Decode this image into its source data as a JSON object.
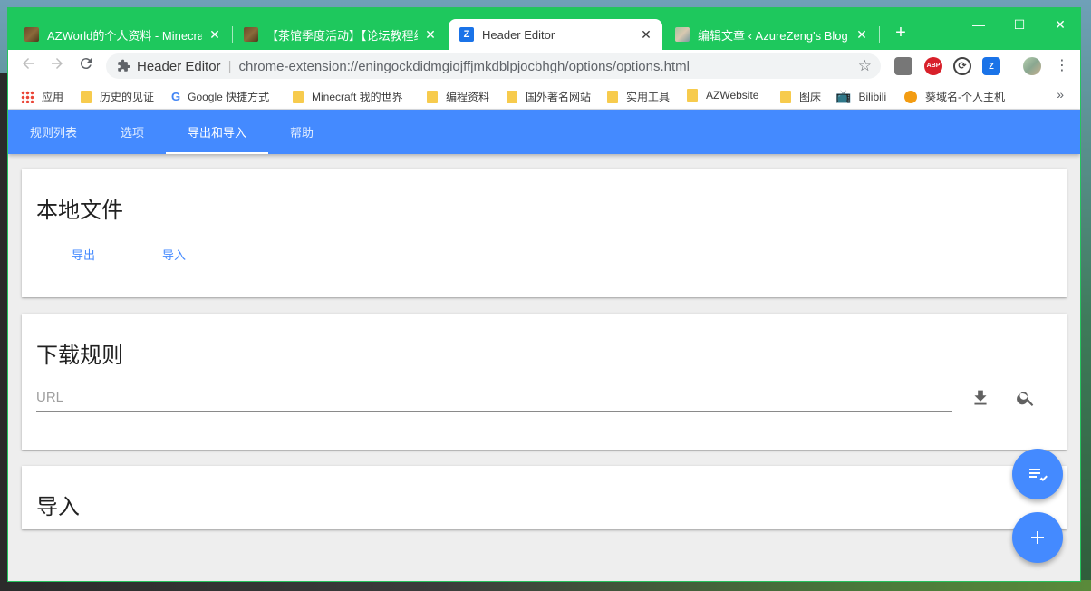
{
  "browser": {
    "tabs": [
      {
        "title": "AZWorld的个人资料 - Minecraft",
        "close": "✕"
      },
      {
        "title": "【茶馆季度活动】【论坛教程组】",
        "close": "✕"
      },
      {
        "title": "Header Editor",
        "close": "✕"
      },
      {
        "title": "编辑文章 ‹ AzureZeng's Blog —",
        "close": "✕"
      }
    ],
    "new_tab": "+",
    "window_controls": {
      "minimize": "—",
      "maximize": "☐",
      "close": "✕"
    },
    "omnibox": {
      "site": "Header Editor",
      "separator": "|",
      "url": "chrome-extension://eningockdidmgiojffjmkdblpjocbhgh/options/options.html"
    },
    "extensions": {
      "abp": "ABP",
      "header_editor": "Z"
    },
    "bookmarks": [
      "应用",
      "历史的见证",
      "Google 快捷方式",
      "Minecraft 我的世界",
      "编程资料",
      "国外著名网站",
      "实用工具",
      "AZWebsite",
      "图床",
      "Bilibili",
      "葵域名-个人主机"
    ],
    "bookmarks_more": "»"
  },
  "app": {
    "nav": [
      "规则列表",
      "选项",
      "导出和导入",
      "帮助"
    ],
    "active_nav": "导出和导入"
  },
  "cards": {
    "local_file": {
      "title": "本地文件",
      "export_label": "导出",
      "import_label": "导入"
    },
    "download_rules": {
      "title": "下载规则",
      "url_placeholder": "URL"
    },
    "import": {
      "title": "导入"
    }
  },
  "colors": {
    "tabstrip": "#1ec85d",
    "accent": "#448aff",
    "card_bg": "#ffffff",
    "page_bg": "#eeeeee"
  }
}
